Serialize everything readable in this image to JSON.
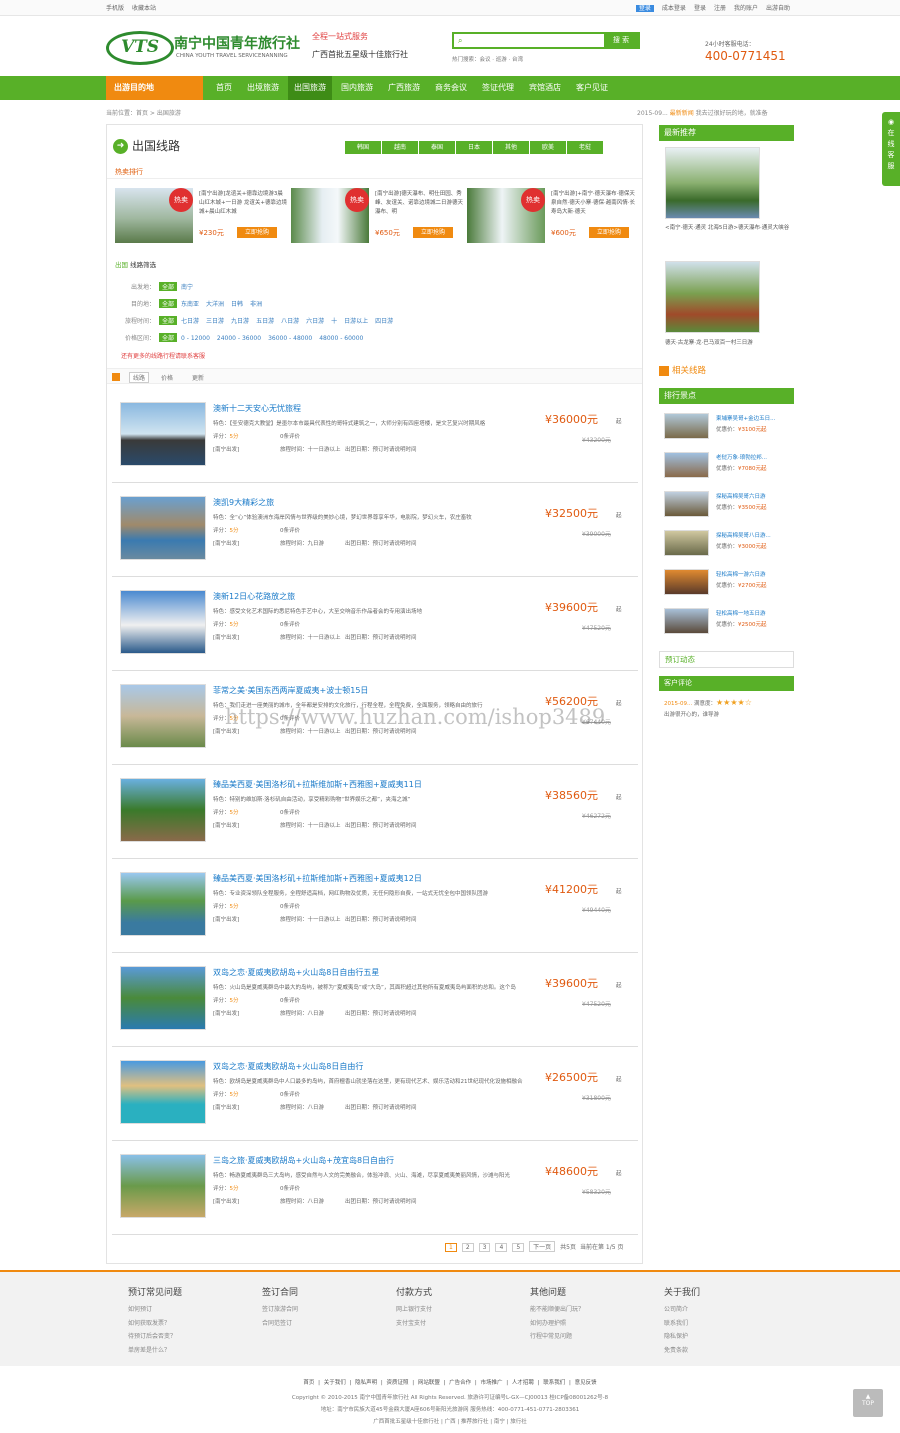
{
  "topbar": {
    "mobile": "手机版",
    "fav": "收藏本站",
    "login": "登录",
    "register": "成本登录",
    "signin": "登录",
    "signup": "注册",
    "account": "我的账户",
    "help": "出游自助"
  },
  "header": {
    "logo_mark": "VTS",
    "logo_cn": "南宁中国青年旅行社",
    "logo_en": "CHINA YOUTH TRAVEL SERVICENANNING",
    "slogan1": "全程一站式服务",
    "slogan2": "广西首批五星级十佳旅行社",
    "search_btn": "搜 索",
    "hot": "热门搜索：会议 · 巡游 · 台湾",
    "phone_label": "24小时客服电话：",
    "phone": "400-0771451"
  },
  "nav": {
    "dest": "出游目的地",
    "items": [
      "首页",
      "出境旅游",
      "出国旅游",
      "国内旅游",
      "广西旅游",
      "商务会议",
      "签证代理",
      "宾馆酒店",
      "客户见证"
    ]
  },
  "crumb": "当前位置：首页 > 出国旅游",
  "news": {
    "date": "2015-09...",
    "title": "最新新闻",
    "text": "我去过很好玩的地，就准备"
  },
  "main": {
    "title": "出国线路",
    "tags": [
      "韩国",
      "越南",
      "泰国",
      "日本",
      "其他",
      "欧美",
      "老挝"
    ],
    "hot_label": "热卖排行",
    "hot": [
      {
        "badge": "热卖",
        "desc": "[南宁出游]龙谊关+德靠边境游3晨山红木城+一日游 龙谊关+德靠边境城+晨山红木城",
        "price": "¥230元",
        "buy": "立即抢购"
      },
      {
        "badge": "热卖",
        "desc": "[南宁出游]德天瀑布、明仕田园、秀峰、友谊关、诺靠边境城二日游德天瀑布、明",
        "price": "¥650元",
        "buy": "立即抢购"
      },
      {
        "badge": "热卖",
        "desc": "[南宁出游]+南宁·德天瀑布·德保天泉自然·德天小寨·德保·越南风情·长寿岛大新·德天",
        "price": "¥600元",
        "buy": "立即抢购"
      }
    ],
    "filter_title_b": "出国",
    "filter_title": "线路筛选",
    "all": "全部",
    "filters": [
      {
        "label": "出发地：",
        "opts": [
          "南宁"
        ]
      },
      {
        "label": "目的地：",
        "opts": [
          "东南亚",
          "大洋洲",
          "日韩",
          "非洲"
        ]
      },
      {
        "label": "旅程时间：",
        "opts": [
          "七日游",
          "三日游",
          "九日游",
          "五日游",
          "八日游",
          "六日游",
          "十",
          "日游以上",
          "四日游"
        ]
      },
      {
        "label": "价格区间：",
        "opts": [
          "0 - 12000",
          "24000 - 36000",
          "36000 - 48000",
          "48000 - 60000"
        ]
      }
    ],
    "note": "还有更多的线路行程请联系客服",
    "sort": [
      "线路",
      "价格",
      "更新"
    ],
    "score_label": "评分：",
    "score": "5分",
    "eval": "0条评价",
    "days_label": "旅程时间：",
    "dep_label": "出团日期：",
    "dep": "预订时请说明时间",
    "city": "[南宁出发]",
    "routes": [
      {
        "name": "澳新十二天安心无忧旅程",
        "feat": "特色：【圣安德克大教堂】是墨尔本市最具代表性的哥特式建筑之一，大师分别有四座塔楼，是文艺复兴时期风格",
        "days": "十一日游以上",
        "price": "¥36000元",
        "old": "¥43200元"
      },
      {
        "name": "澳凯9大精彩之旅",
        "feat": "特色：全“心”体验澳洲东海岸风情与世界级的美妙心境，梦幻世界尊享年华，电影院，梦幻火车，农庄畜牧",
        "days": "九日游",
        "price": "¥32500元",
        "old": "¥39000元"
      },
      {
        "name": "澳新12日心花路放之旅",
        "feat": "特色：感受文化艺术国际的悉尼特色手艺中心，大至交响音乐作品者会的专用演出场地",
        "days": "十一日游以上",
        "price": "¥39600元",
        "old": "¥47520元"
      },
      {
        "name": "菲常之美·美国东西两岸夏威夷+波士顿15日",
        "feat": "特色：我们走进一座美丽的城市，全年都是安排的文化旅行，行程全程，全程免费，全面服务，领略自由的旅行",
        "days": "十一日游以上",
        "price": "¥56200元",
        "old": "¥67440元"
      },
      {
        "name": "臻品美西夏·美国洛杉矶+拉斯维加斯+西雅图+夏威夷11日",
        "feat": "特色：特别的维加斯·洛杉矶自由活动，享受精彩购物“世界娱乐之都”，夹海之城”",
        "days": "十一日游以上",
        "price": "¥38560元",
        "old": "¥46272元"
      },
      {
        "name": "臻品美西夏·美国洛杉矶+拉斯维加斯+西雅图+夏威夷12日",
        "feat": "特色：专业资深领队全程服务，全程舒适高档，网红购物及优质，无任何隐形自费，一站式无忧全包中国领队团游",
        "days": "十一日游以上",
        "price": "¥41200元",
        "old": "¥49440元"
      },
      {
        "name": "双岛之恋·夏威夷欧胡岛+火山岛8日自由行五星",
        "feat": "特色：火山岛是夏威夷群岛中最大的岛屿，被称为“夏威夷岛”或“大岛”，其面积超过其他所有夏威夷岛屿面积的总和。这个岛",
        "days": "八日游",
        "price": "¥39600元",
        "old": "¥47520元"
      },
      {
        "name": "双岛之恋·夏威夷欧胡岛+火山岛8日自由行",
        "feat": "特色：欧胡岛是夏威夷群岛中人口最多的岛屿，首府檀香山就坐落在这里，更有现代艺术、娱乐活动和21世纪现代化设施相融合",
        "days": "八日游",
        "price": "¥26500元",
        "old": "¥31800元"
      },
      {
        "name": "三岛之旅·夏威夷欧胡岛+火山岛+茂宜岛8日自由行",
        "feat": "特色：畅游夏威夷群岛三大岛屿，感受自然与人文的完美融合，体验冲浪、火山、海滩，尽享夏威夷美丽风情，沙滩与阳光",
        "days": "八日游",
        "price": "¥48600元",
        "old": "¥58320元"
      }
    ],
    "qi": "起",
    "pager": {
      "pages": [
        "1",
        "2",
        "3",
        "4",
        "5"
      ],
      "next": "下一页",
      "total": "共5页",
      "cur": "当前在第 1/5 页"
    }
  },
  "side": {
    "latest": "最新推荐",
    "latest_items": [
      "<南宁·德天·通灵 北海5日游>德天瀑布·通灵大峡谷",
      "德天·古龙寨·龙·巴马双百一村三日游"
    ],
    "related": "相关线路",
    "rank": "排行景点",
    "rank_items": [
      {
        "n": "柬埔寨吴哥+金边五日...",
        "v": "¥3100元起"
      },
      {
        "n": "老挝万象·琅勃拉邦...",
        "v": "¥7080元起"
      },
      {
        "n": "探秘高棉吴哥六日游",
        "v": "¥3500元起"
      },
      {
        "n": "探秘高棉吴哥八日游...",
        "v": "¥3000元起"
      },
      {
        "n": "轻松高棉一游六日游",
        "v": "¥2700元起"
      },
      {
        "n": "轻松高棉一地五日游",
        "v": "¥2500元起"
      }
    ],
    "rank_price_label": "优惠价：",
    "booking": "预订动态",
    "review": "客户评论",
    "review_date": "2015-09...",
    "review_sat": "满意度：",
    "review_stars": "★★★★☆",
    "review_text": "出游很开心的，谁导游"
  },
  "kefu": "在线客服",
  "footer": {
    "cols": [
      {
        "h": "预订常见问题",
        "items": [
          "如何预订",
          "如何获取发票？",
          "待预订后会否变？",
          "单房差是什么？"
        ]
      },
      {
        "h": "签订合同",
        "items": [
          "签订旅游合同",
          "合同范签订"
        ]
      },
      {
        "h": "付款方式",
        "items": [
          "网上银行支付",
          "支付宝支付"
        ]
      },
      {
        "h": "其他问题",
        "items": [
          "能不能顺便出门玩？",
          "如何办理护照",
          "行程中常见问题"
        ]
      },
      {
        "h": "关于我们",
        "items": [
          "公司简介",
          "联系我们",
          "隐私保护",
          "免责条款"
        ]
      }
    ],
    "links": "首页 | 关于我们 | 隐私声明 | 资质证照 | 网站联盟 | 广告合作 | 市场推广 | 人才招聘 | 联系我们 | 意见反馈",
    "copy1": "Copyright © 2010-2015 南宁中国青年旅行社 All Rights Reserved. 旅游许可证编号L-GX—CJ00013  桂ICP备08001262号-8",
    "copy2": "地址：南宁市民族大道45号金鼎大厦A座606号新阳光旅游网  服务热线：400-0771-451-0771-2803361",
    "copy3": "广西首批五星级十佳旅行社 | 广西 | 推荐旅行社 | 南宁 | 旅行社",
    "top": "TOP"
  },
  "watermark": "https://www.huzhan.com/ishop3489"
}
